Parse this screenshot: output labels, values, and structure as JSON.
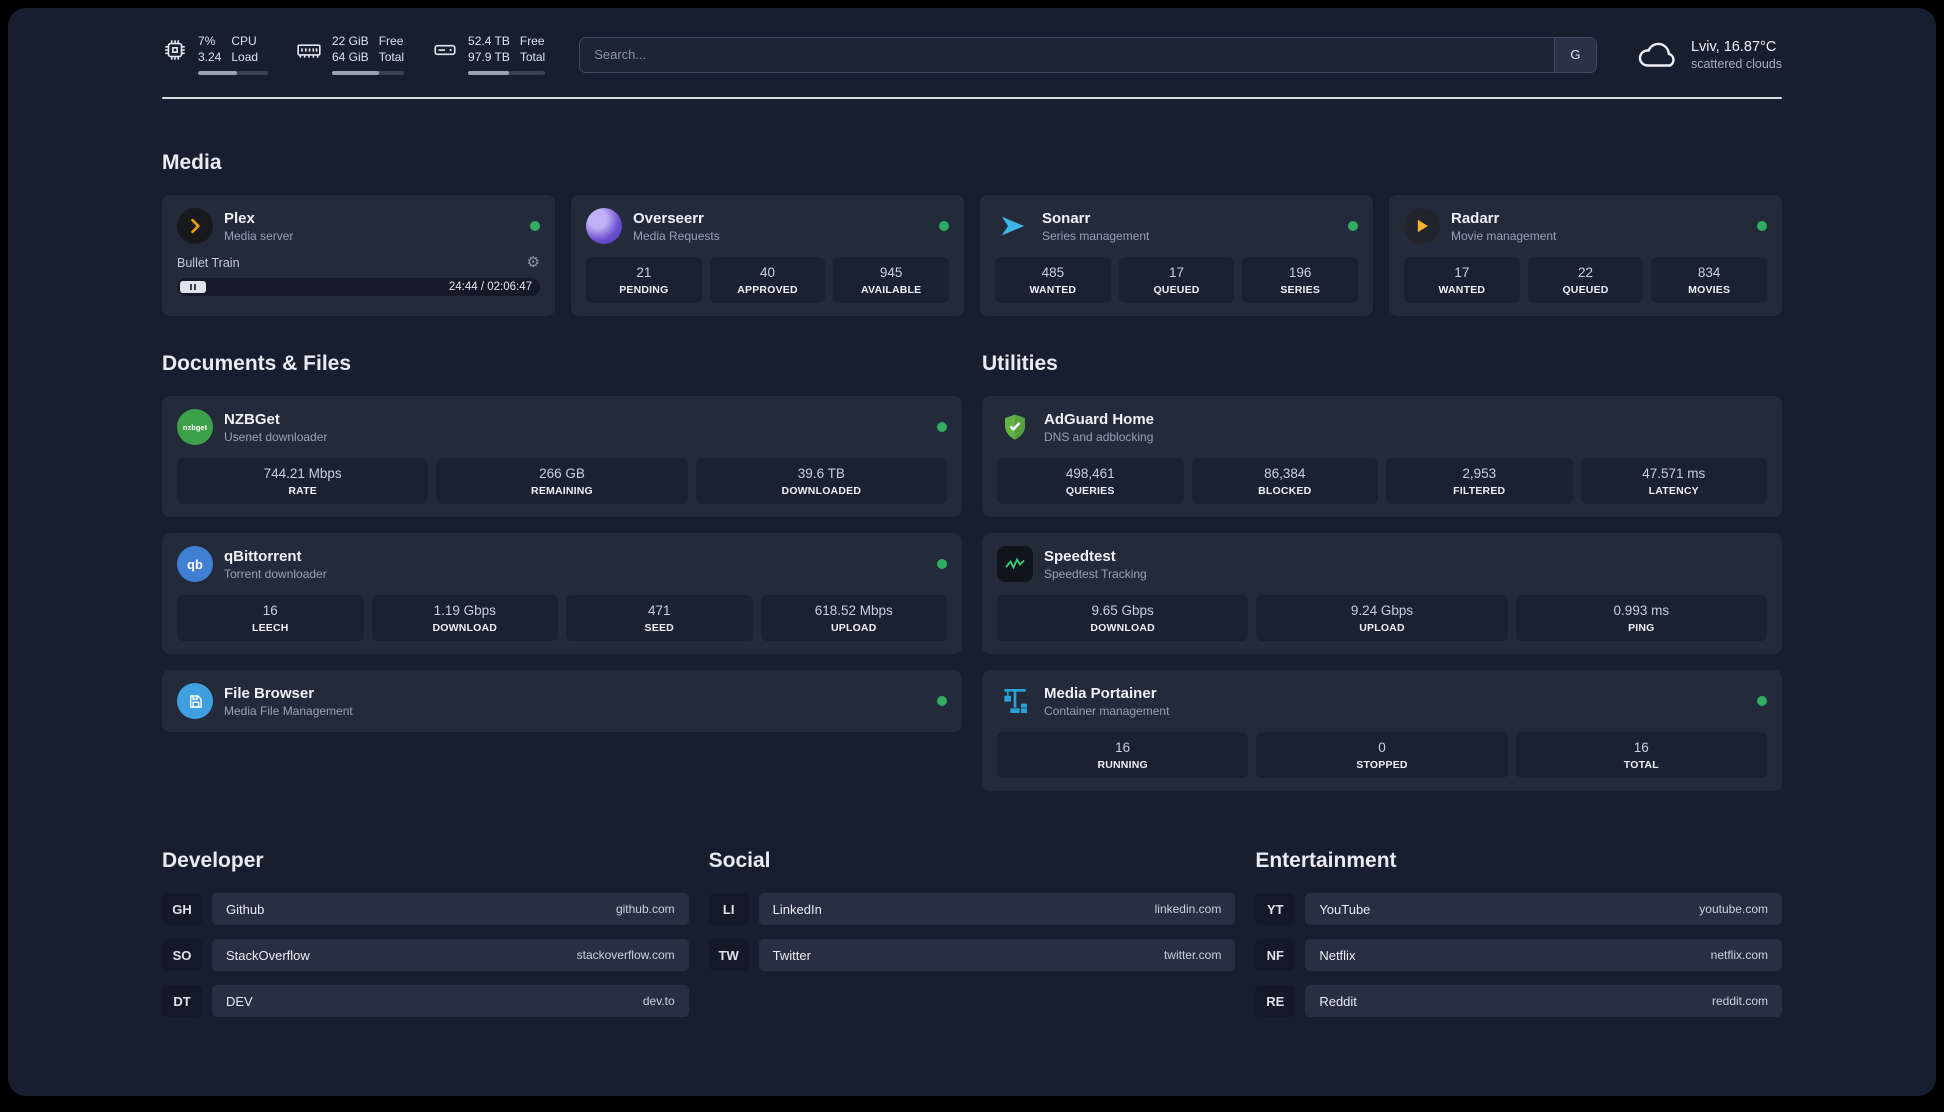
{
  "topbar": {
    "cpu": {
      "value": "7%",
      "load": "3.24",
      "label_top": "CPU",
      "label_bottom": "Load"
    },
    "ram": {
      "free": "22 GiB",
      "total": "64 GiB",
      "label_top": "Free",
      "label_bottom": "Total"
    },
    "disk": {
      "free": "52.4 TB",
      "total": "97.9 TB",
      "label_top": "Free",
      "label_bottom": "Total"
    },
    "search": {
      "placeholder": "Search...",
      "engine_button": "G"
    },
    "weather": {
      "location": "Lviv, 16.87°C",
      "condition": "scattered clouds"
    }
  },
  "media": {
    "title": "Media",
    "plex": {
      "name": "Plex",
      "subtitle": "Media server",
      "now_playing": "Bullet Train",
      "time": "24:44 / 02:06:47"
    },
    "overseerr": {
      "name": "Overseerr",
      "subtitle": "Media Requests",
      "stats": [
        {
          "value": "21",
          "label": "PENDING"
        },
        {
          "value": "40",
          "label": "APPROVED"
        },
        {
          "value": "945",
          "label": "AVAILABLE"
        }
      ]
    },
    "sonarr": {
      "name": "Sonarr",
      "subtitle": "Series management",
      "stats": [
        {
          "value": "485",
          "label": "WANTED"
        },
        {
          "value": "17",
          "label": "QUEUED"
        },
        {
          "value": "196",
          "label": "SERIES"
        }
      ]
    },
    "radarr": {
      "name": "Radarr",
      "subtitle": "Movie management",
      "stats": [
        {
          "value": "17",
          "label": "WANTED"
        },
        {
          "value": "22",
          "label": "QUEUED"
        },
        {
          "value": "834",
          "label": "MOVIES"
        }
      ]
    }
  },
  "documents": {
    "title": "Documents & Files",
    "nzbget": {
      "name": "NZBGet",
      "subtitle": "Usenet downloader",
      "icon_text": "nzbget",
      "stats": [
        {
          "value": "744.21 Mbps",
          "label": "RATE"
        },
        {
          "value": "266 GB",
          "label": "REMAINING"
        },
        {
          "value": "39.6 TB",
          "label": "DOWNLOADED"
        }
      ]
    },
    "qbittorrent": {
      "name": "qBittorrent",
      "subtitle": "Torrent downloader",
      "icon_text": "qb",
      "stats": [
        {
          "value": "16",
          "label": "LEECH"
        },
        {
          "value": "1.19 Gbps",
          "label": "DOWNLOAD"
        },
        {
          "value": "471",
          "label": "SEED"
        },
        {
          "value": "618.52 Mbps",
          "label": "UPLOAD"
        }
      ]
    },
    "filebrowser": {
      "name": "File Browser",
      "subtitle": "Media File Management"
    }
  },
  "utilities": {
    "title": "Utilities",
    "adguard": {
      "name": "AdGuard Home",
      "subtitle": "DNS and adblocking",
      "stats": [
        {
          "value": "498,461",
          "label": "QUERIES"
        },
        {
          "value": "86,384",
          "label": "BLOCKED"
        },
        {
          "value": "2,953",
          "label": "FILTERED"
        },
        {
          "value": "47.571 ms",
          "label": "LATENCY"
        }
      ]
    },
    "speedtest": {
      "name": "Speedtest",
      "subtitle": "Speedtest Tracking",
      "stats": [
        {
          "value": "9.65 Gbps",
          "label": "DOWNLOAD"
        },
        {
          "value": "9.24 Gbps",
          "label": "UPLOAD"
        },
        {
          "value": "0.993 ms",
          "label": "PING"
        }
      ]
    },
    "portainer": {
      "name": "Media Portainer",
      "subtitle": "Container management",
      "stats": [
        {
          "value": "16",
          "label": "RUNNING"
        },
        {
          "value": "0",
          "label": "STOPPED"
        },
        {
          "value": "16",
          "label": "TOTAL"
        }
      ]
    }
  },
  "bookmarks": {
    "developer": {
      "title": "Developer",
      "links": [
        {
          "abbr": "GH",
          "name": "Github",
          "domain": "github.com"
        },
        {
          "abbr": "SO",
          "name": "StackOverflow",
          "domain": "stackoverflow.com"
        },
        {
          "abbr": "DT",
          "name": "DEV",
          "domain": "dev.to"
        }
      ]
    },
    "social": {
      "title": "Social",
      "links": [
        {
          "abbr": "LI",
          "name": "LinkedIn",
          "domain": "linkedin.com"
        },
        {
          "abbr": "TW",
          "name": "Twitter",
          "domain": "twitter.com"
        }
      ]
    },
    "entertainment": {
      "title": "Entertainment",
      "links": [
        {
          "abbr": "YT",
          "name": "YouTube",
          "domain": "youtube.com"
        },
        {
          "abbr": "NF",
          "name": "Netflix",
          "domain": "netflix.com"
        },
        {
          "abbr": "RE",
          "name": "Reddit",
          "domain": "reddit.com"
        }
      ]
    }
  },
  "colors": {
    "background": "#171e2d",
    "card": "#232b3b",
    "tile": "#1a2130",
    "status_online": "#2fae62",
    "plex_accent": "#e5a00d",
    "sonarr_accent": "#3fb6e3",
    "radarr_accent": "#f6b32b"
  }
}
